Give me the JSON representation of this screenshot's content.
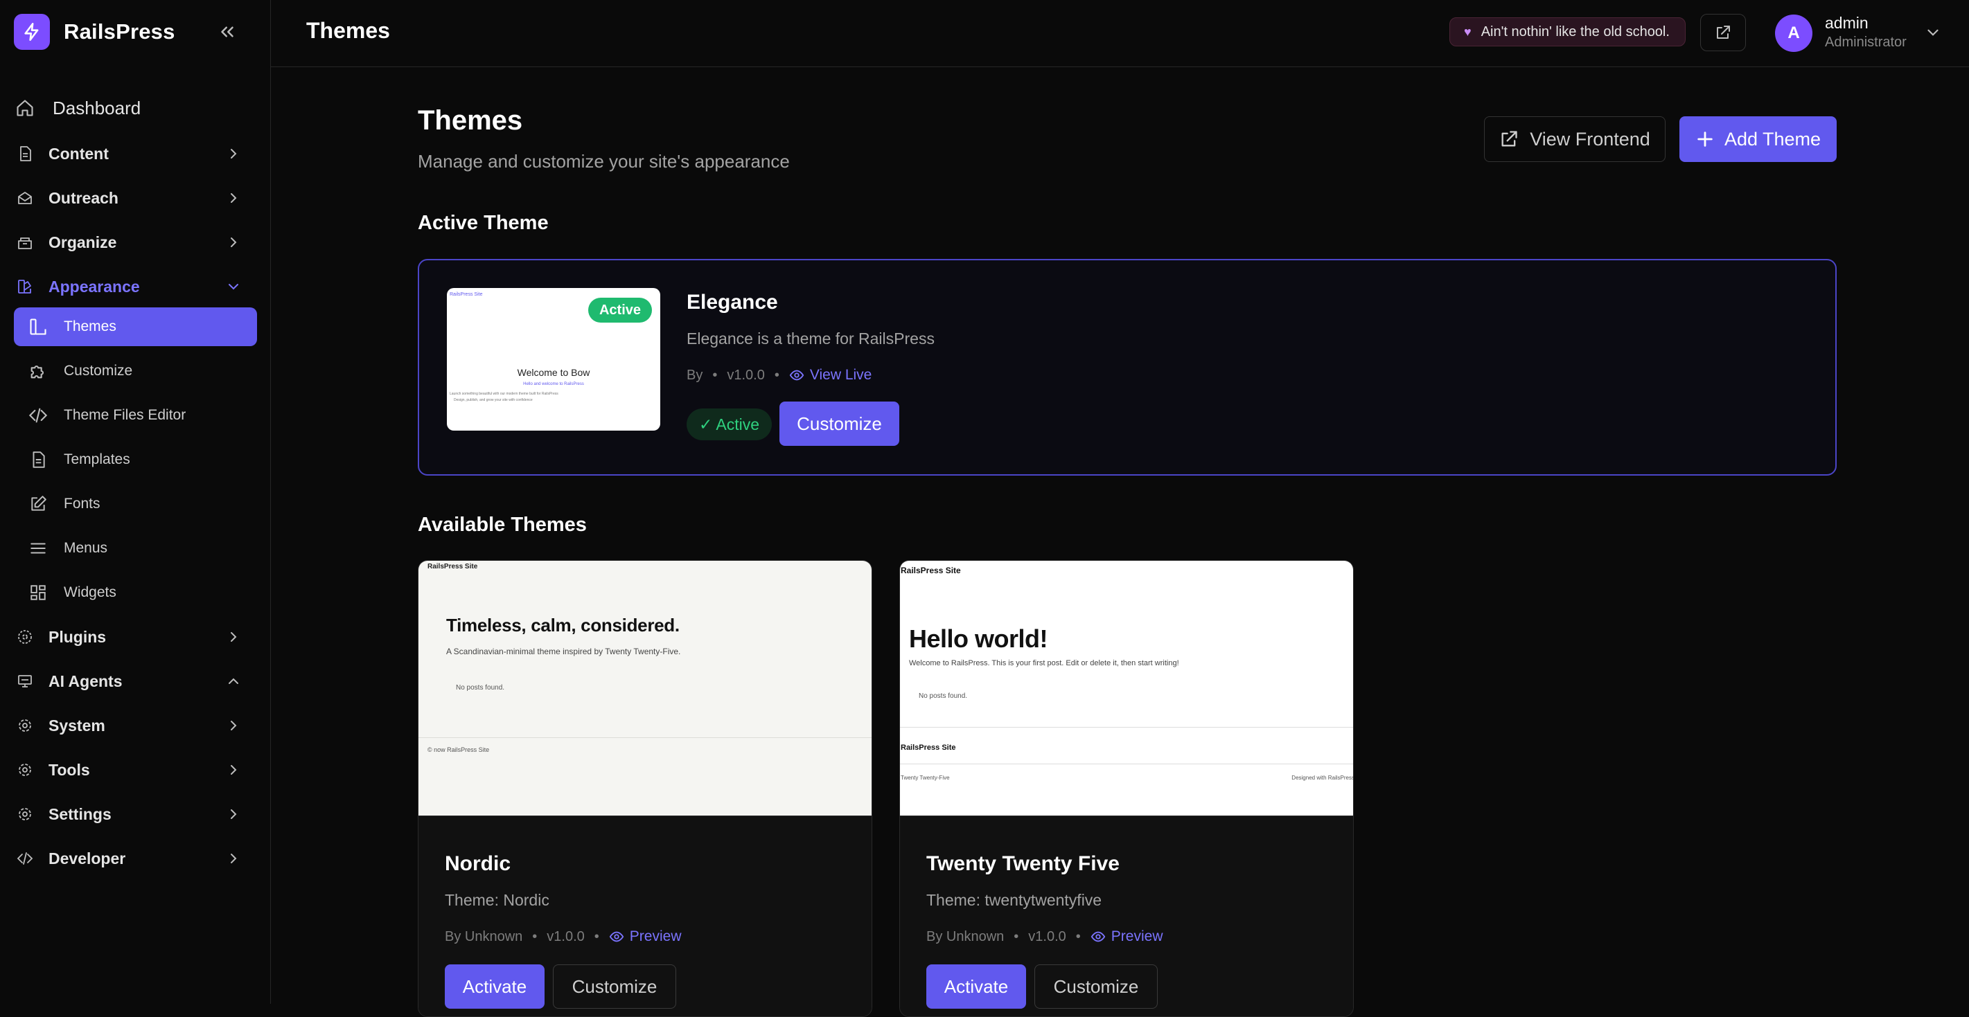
{
  "brand": {
    "name": "RailsPress"
  },
  "sidebar": {
    "dashboard": "Dashboard",
    "content": "Content",
    "outreach": "Outreach",
    "organize": "Organize",
    "appearance": "Appearance",
    "appearance_items": [
      "Themes",
      "Customize",
      "Theme Files Editor",
      "Templates",
      "Fonts",
      "Menus",
      "Widgets"
    ],
    "plugins": "Plugins",
    "ai_agents": "AI Agents",
    "system": "System",
    "tools": "Tools",
    "settings": "Settings",
    "developer": "Developer"
  },
  "topbar": {
    "title": "Themes",
    "quote": "Ain't nothin' like the old school.",
    "user_initial": "A",
    "user_name": "admin",
    "user_role": "Administrator"
  },
  "page": {
    "title": "Themes",
    "subtitle": "Manage and customize your site's appearance",
    "view_frontend": "View Frontend",
    "add_theme": "Add Theme",
    "active_section": "Active Theme",
    "available_section": "Available Themes"
  },
  "active_theme": {
    "name": "Elegance",
    "description": "Elegance is a theme for RailsPress",
    "by": "By",
    "version": "v1.0.0",
    "view_live": "View Live",
    "status": "✓ Active",
    "badge": "Active",
    "customize": "Customize",
    "thumb": {
      "site_link": "RailsPress Site",
      "heading": "Welcome to Bow",
      "link": "Hello and welcome to RailsPress",
      "line1": "Launch something beautiful with our modern theme built for RailsPress",
      "line2": "Design, publish, and grow your site with confidence"
    }
  },
  "themes": [
    {
      "name": "Nordic",
      "label": "Theme: Nordic",
      "by": "By Unknown",
      "version": "v1.0.0",
      "preview": "Preview",
      "activate": "Activate",
      "customize": "Customize",
      "thumb": {
        "site": "RailsPress Site",
        "heading": "Timeless, calm, considered.",
        "tagline": "A Scandinavian-minimal theme inspired by Twenty Twenty-Five.",
        "empty": "No posts found.",
        "footer": "© now RailsPress Site"
      }
    },
    {
      "name": "Twenty Twenty Five",
      "label": "Theme: twentytwentyfive",
      "by": "By Unknown",
      "version": "v1.0.0",
      "preview": "Preview",
      "activate": "Activate",
      "customize": "Customize",
      "thumb": {
        "site": "RailsPress Site",
        "heading": "Hello world!",
        "tagline": "Welcome to RailsPress. This is your first post. Edit or delete it, then start writing!",
        "empty": "No posts found.",
        "footer_site": "RailsPress Site",
        "footer_left": "Twenty Twenty-Five",
        "footer_right": "Designed with RailsPress"
      }
    }
  ],
  "colors": {
    "accent": "#6159ee",
    "brand": "#7c4dff",
    "success": "#1fba6f",
    "background": "#0a0a0a"
  }
}
